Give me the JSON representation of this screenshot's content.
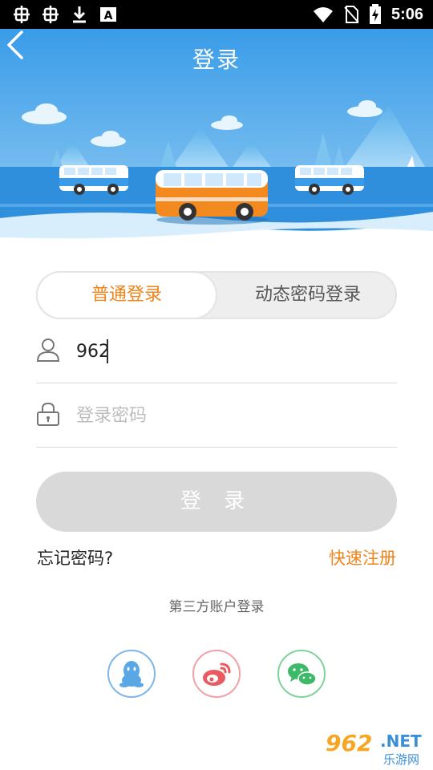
{
  "status_bar": {
    "time": "5:06",
    "left_icons": [
      "bug-icon",
      "bug-icon",
      "download-icon",
      "font-a-icon"
    ],
    "right_icons": [
      "wifi-icon",
      "no-sim-icon",
      "battery-charging-icon"
    ]
  },
  "header": {
    "title": "登录",
    "back_icon": "back-chevron-icon"
  },
  "tabs": [
    {
      "label": "普通登录",
      "active": true
    },
    {
      "label": "动态密码登录",
      "active": false
    }
  ],
  "form": {
    "username_value": "962",
    "username_icon": "user-icon",
    "password_placeholder": "登录密码",
    "password_icon": "lock-icon"
  },
  "login_button": "登 录",
  "links": {
    "forgot": "忘记密码?",
    "register": "快速注册"
  },
  "third_party": {
    "label": "第三方账户登录",
    "providers": [
      "qq-icon",
      "weibo-icon",
      "wechat-icon"
    ]
  },
  "watermark": {
    "big": "962",
    "net": ".NET",
    "sub": "乐游网"
  },
  "colors": {
    "accent": "#f08319",
    "sky": "#3ea1e8",
    "button_disabled": "#d9d9d9"
  }
}
